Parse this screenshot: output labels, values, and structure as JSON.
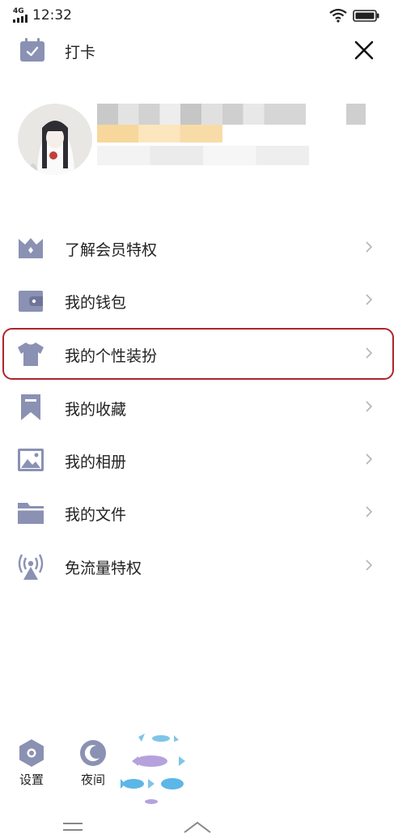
{
  "status_bar": {
    "network": "4G",
    "time": "12:32"
  },
  "header": {
    "punch_label": "打卡"
  },
  "menu": {
    "items": [
      {
        "label": "了解会员特权",
        "icon": "vip-crown-icon"
      },
      {
        "label": "我的钱包",
        "icon": "wallet-icon"
      },
      {
        "label": "我的个性装扮",
        "icon": "tshirt-icon"
      },
      {
        "label": "我的收藏",
        "icon": "bookmark-icon"
      },
      {
        "label": "我的相册",
        "icon": "photo-album-icon"
      },
      {
        "label": "我的文件",
        "icon": "folder-icon"
      },
      {
        "label": "免流量特权",
        "icon": "signal-tower-icon"
      }
    ],
    "highlighted_index": 2
  },
  "bottom": {
    "settings_label": "设置",
    "night_label": "夜间"
  },
  "colors": {
    "icon": "#8b91b3",
    "highlight": "#b0232b",
    "chevron": "#b5b5b5"
  }
}
